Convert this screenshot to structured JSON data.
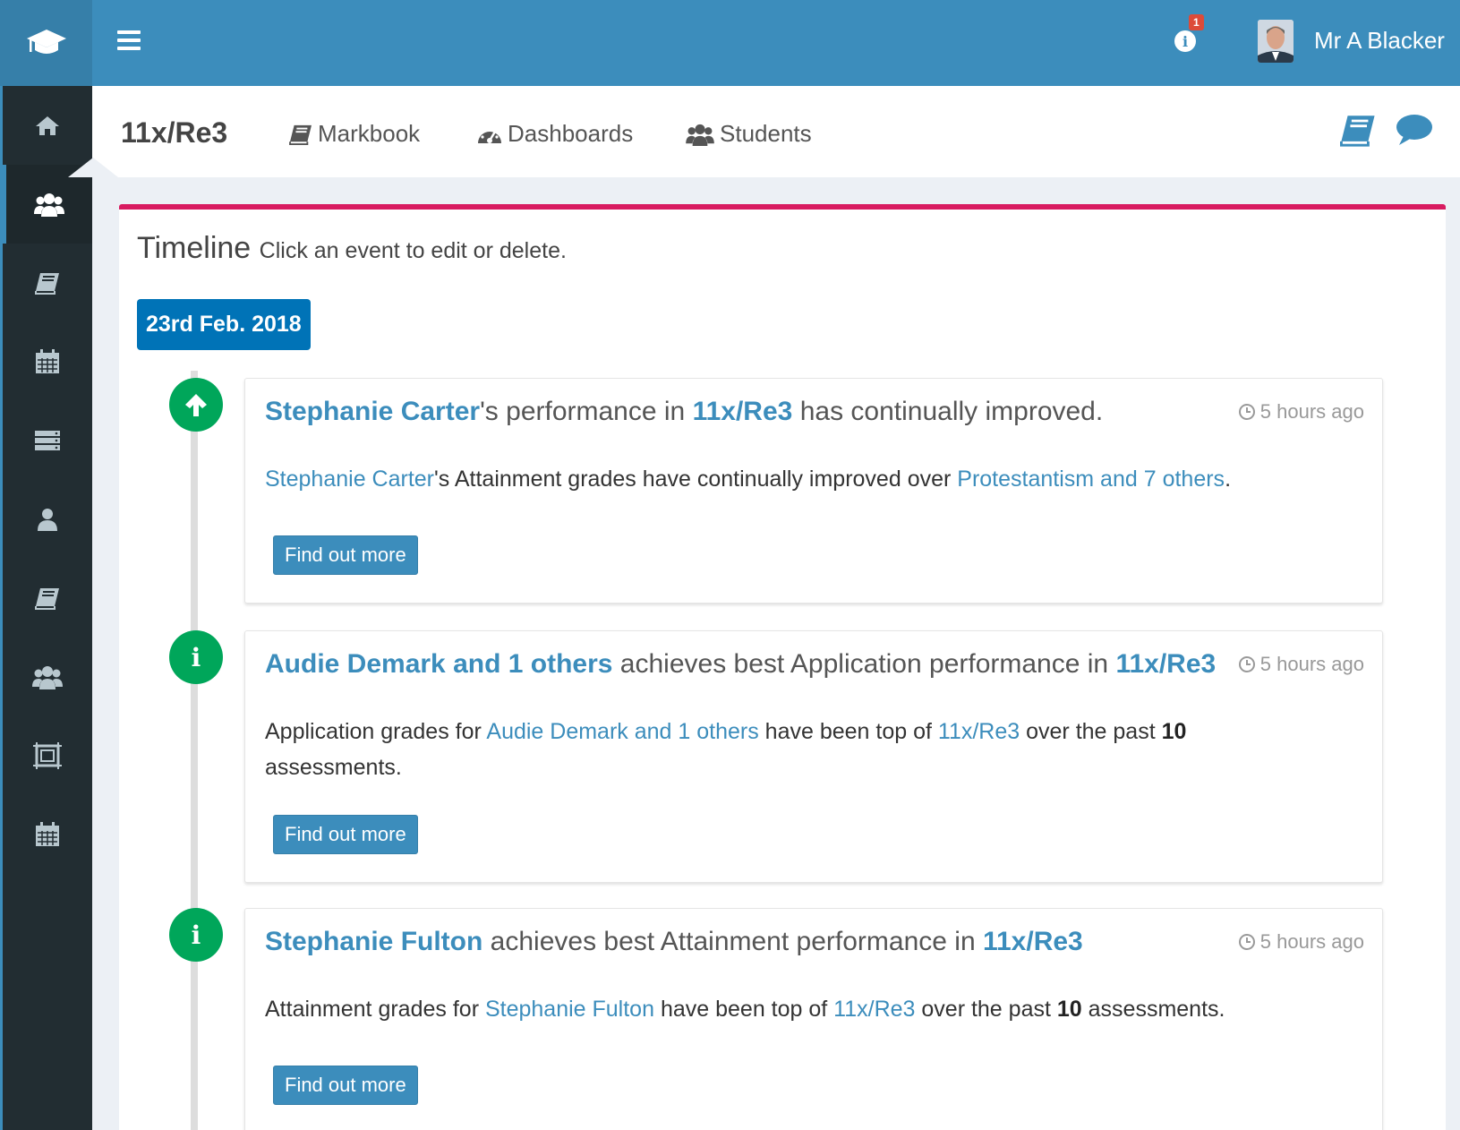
{
  "header": {
    "notification_count": "1",
    "user_name": "Mr A Blacker"
  },
  "sidebar": {
    "items": [
      "home-icon",
      "users-icon",
      "book-icon",
      "calendar-icon",
      "list-icon",
      "user-icon",
      "book-icon",
      "users-icon",
      "frame-icon",
      "calendar-icon"
    ],
    "active_index": 1
  },
  "subheader": {
    "title": "11x/Re3",
    "tabs": [
      {
        "label": "Markbook",
        "icon": "book-icon"
      },
      {
        "label": "Dashboards",
        "icon": "dashboard-icon"
      },
      {
        "label": "Students",
        "icon": "users-icon"
      }
    ]
  },
  "timeline": {
    "title": "Timeline",
    "subtitle": "Click an event to edit or delete.",
    "date_label": "23rd Feb. 2018",
    "events": [
      {
        "icon": "arrow-up-icon",
        "header": {
          "name": "Stephanie Carter",
          "t1": "'s performance in ",
          "class": "11x/Re3",
          "t2": " has continually improved."
        },
        "time": "5 hours ago",
        "body": {
          "name": "Stephanie Carter",
          "t1": "'s Attainment grades have continually improved over ",
          "subjects": "Protestantism and 7 others",
          "t2": "."
        },
        "button": "Find out more"
      },
      {
        "icon": "info-icon",
        "header": {
          "name": "Audie Demark and 1 others",
          "t1": " achieves best Application performance in ",
          "class": "11x/Re3"
        },
        "time": "5 hours ago",
        "body": {
          "t0": "Application grades for ",
          "name": "Audie Demark and 1 others",
          "t1": " have been top of ",
          "class": "11x/Re3",
          "t2": " over the past ",
          "count": "10",
          "t3": "assessments."
        },
        "button": "Find out more"
      },
      {
        "icon": "info-icon",
        "header": {
          "name": "Stephanie Fulton",
          "t1": " achieves best Attainment performance in ",
          "class": "11x/Re3"
        },
        "time": "5 hours ago",
        "body": {
          "t0": "Attainment grades for ",
          "name": "Stephanie Fulton",
          "t1": " have been top of ",
          "class": "11x/Re3",
          "t2": " over the past ",
          "count": "10",
          "t3": " assessments."
        },
        "button": "Find out more"
      }
    ]
  }
}
